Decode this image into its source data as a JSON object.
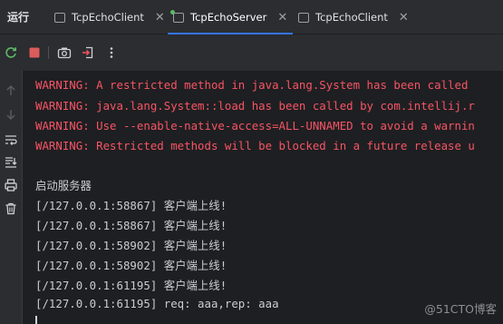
{
  "colors": {
    "warning": "#f75464",
    "accent": "#3574f0",
    "running_dot": "#5fb865",
    "stop": "#db5c5c"
  },
  "run_panel": {
    "title": "运行",
    "tabs": [
      {
        "label": "TcpEchoClient",
        "active": false
      },
      {
        "label": "TcpEchoServer",
        "active": true
      },
      {
        "label": "TcpEchoClient",
        "active": false
      }
    ]
  },
  "toolbar": {
    "icons": [
      "rerun-icon",
      "stop-icon",
      "camera-icon",
      "exit-icon",
      "more-icon"
    ]
  },
  "gutter": {
    "icons": [
      "scroll-up-icon",
      "scroll-down-icon",
      "soft-wrap-icon",
      "scroll-to-end-icon",
      "print-icon",
      "clear-icon"
    ]
  },
  "console": {
    "lines": [
      {
        "text": "WARNING: A restricted method in java.lang.System has been called",
        "kind": "warn"
      },
      {
        "text": "WARNING: java.lang.System::load has been called by com.intellij.r",
        "kind": "warn"
      },
      {
        "text": "WARNING: Use --enable-native-access=ALL-UNNAMED to avoid a warnin",
        "kind": "warn"
      },
      {
        "text": "WARNING: Restricted methods will be blocked in a future release u",
        "kind": "warn"
      },
      {
        "text": "",
        "kind": "out"
      },
      {
        "text": "启动服务器",
        "kind": "out"
      },
      {
        "text": "[/127.0.0.1:58867] 客户端上线!",
        "kind": "out"
      },
      {
        "text": "[/127.0.0.1:58867] 客户端上线!",
        "kind": "out"
      },
      {
        "text": "[/127.0.0.1:58902] 客户端上线!",
        "kind": "out"
      },
      {
        "text": "[/127.0.0.1:58902] 客户端上线!",
        "kind": "out"
      },
      {
        "text": "[/127.0.0.1:61195] 客户端上线!",
        "kind": "out"
      },
      {
        "text": "[/127.0.0.1:61195] req: aaa,rep: aaa",
        "kind": "out"
      }
    ]
  },
  "watermark": "@51CTO博客"
}
